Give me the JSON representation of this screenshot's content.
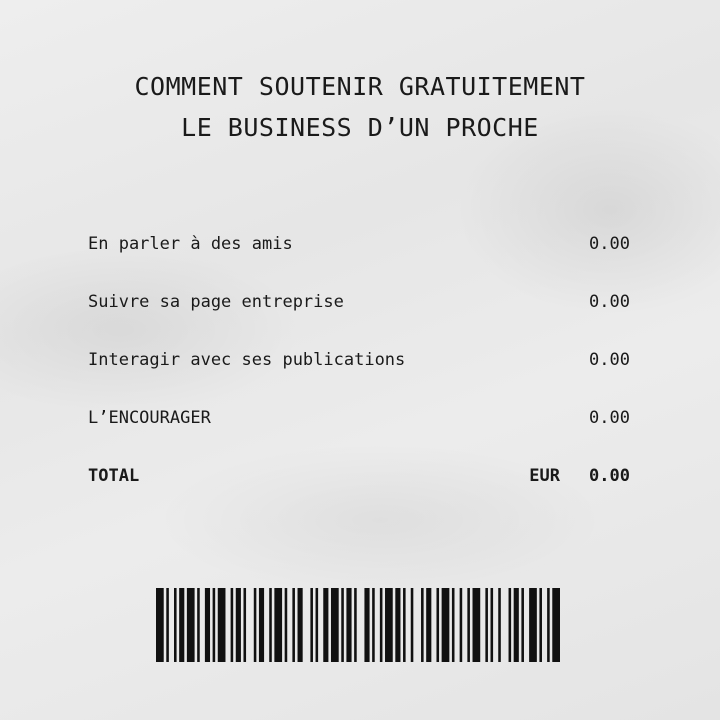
{
  "receipt": {
    "title_line_1": "COMMENT SOUTENIR GRATUITEMENT",
    "title_line_2": "LE BUSINESS D’UN PROCHE",
    "items": [
      {
        "label": "En parler à des amis",
        "amount": "0.00"
      },
      {
        "label": "Suivre sa page entreprise",
        "amount": "0.00"
      },
      {
        "label": "Interagir avec ses publications",
        "amount": "0.00"
      },
      {
        "label": "L’ENCOURAGER",
        "amount": "0.00"
      }
    ],
    "total": {
      "label": "TOTAL",
      "currency": "EUR",
      "amount": "0.00"
    }
  },
  "barcode_pattern": [
    3,
    1,
    1,
    2,
    1,
    1,
    2,
    1,
    3,
    1,
    1,
    2,
    2,
    1,
    1,
    1,
    3,
    2,
    1,
    1,
    2,
    1,
    1,
    3,
    1,
    1,
    2,
    2,
    1,
    1,
    3,
    1,
    1,
    2,
    1,
    1,
    2,
    3,
    1,
    1,
    1,
    2,
    2,
    1,
    3,
    1,
    1,
    1,
    2,
    1,
    1,
    3,
    2,
    1,
    1,
    2,
    1,
    1,
    3,
    1,
    2,
    1,
    1,
    2,
    1,
    3,
    1,
    1,
    2,
    2,
    1,
    1,
    3,
    1,
    1,
    2,
    1,
    2,
    1,
    1,
    3,
    2,
    1,
    1,
    1,
    2,
    1,
    3,
    1,
    1,
    2,
    1,
    1,
    2,
    3,
    1,
    1,
    2,
    1,
    1,
    3
  ]
}
